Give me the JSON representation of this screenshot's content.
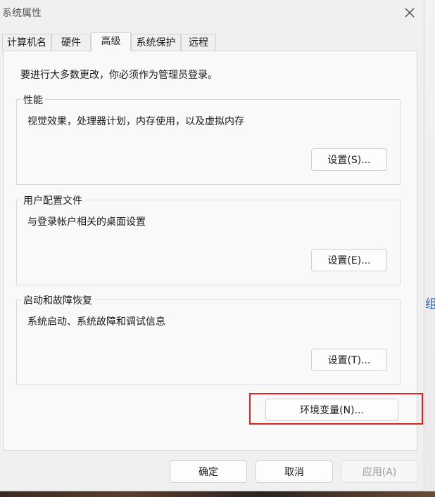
{
  "dialog": {
    "title": "系统属性",
    "tabs": [
      {
        "label": "计算机名"
      },
      {
        "label": "硬件"
      },
      {
        "label": "高级"
      },
      {
        "label": "系统保护"
      },
      {
        "label": "远程"
      }
    ],
    "active_tab": "高级",
    "intro_text": "要进行大多数更改，你必须作为管理员登录。",
    "performance": {
      "legend": "性能",
      "description": "视觉效果，处理器计划，内存使用，以及虚拟内存",
      "button": "设置(S)..."
    },
    "user_profiles": {
      "legend": "用户配置文件",
      "description": "与登录帐户相关的桌面设置",
      "button": "设置(E)..."
    },
    "startup_recovery": {
      "legend": "启动和故障恢复",
      "description": "系统启动、系统故障和调试信息",
      "button": "设置(T)..."
    },
    "env_button": "环境变量(N)...",
    "footer": {
      "ok": "确定",
      "cancel": "取消",
      "apply": "应用(A)"
    }
  },
  "background": {
    "partial_text": "组"
  },
  "colors": {
    "highlight_border": "#e02020",
    "dialog_bg": "#f0f0f0",
    "panel_bg": "#f9f9f9"
  },
  "icons": {
    "close": "close-icon"
  }
}
